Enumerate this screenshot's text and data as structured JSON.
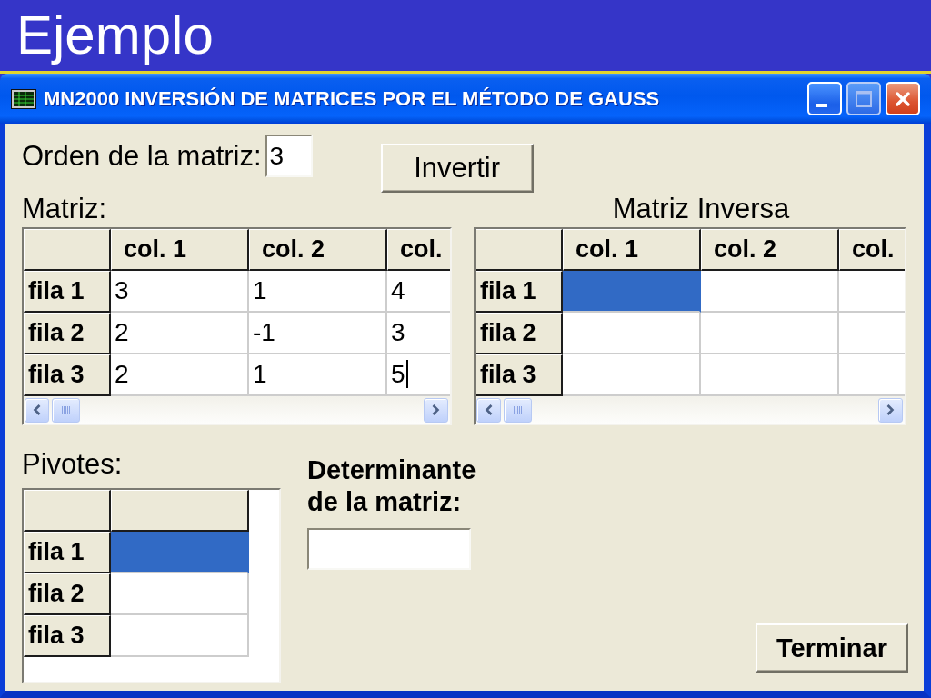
{
  "slide": {
    "title": "Ejemplo"
  },
  "window": {
    "title": "MN2000 INVERSIÓN DE MATRICES POR EL MÉTODO DE GAUSS",
    "controls": [
      {
        "kind": "minimize",
        "disabled": false
      },
      {
        "kind": "maximize",
        "disabled": true
      },
      {
        "kind": "close",
        "disabled": false
      }
    ]
  },
  "order": {
    "label": "Orden de la matriz:",
    "value": "3"
  },
  "invert_button": {
    "label": "Invertir"
  },
  "matrix": {
    "label": "Matriz:",
    "columns": [
      "col. 1",
      "col. 2",
      "col."
    ],
    "rows": [
      {
        "header": "fila 1",
        "cells": [
          {
            "value": "3",
            "selected": false,
            "caret": false
          },
          {
            "value": "1",
            "selected": false,
            "caret": false
          },
          {
            "value": "4",
            "selected": false,
            "caret": false
          }
        ]
      },
      {
        "header": "fila 2",
        "cells": [
          {
            "value": "2",
            "selected": false,
            "caret": false
          },
          {
            "value": "-1",
            "selected": false,
            "caret": false
          },
          {
            "value": "3",
            "selected": false,
            "caret": false
          }
        ]
      },
      {
        "header": "fila 3",
        "cells": [
          {
            "value": "2",
            "selected": false,
            "caret": false
          },
          {
            "value": "1",
            "selected": false,
            "caret": false
          },
          {
            "value": "5",
            "selected": false,
            "caret": true
          }
        ]
      }
    ]
  },
  "inverse_matrix": {
    "label": "Matriz Inversa",
    "columns": [
      "col. 1",
      "col. 2",
      "col."
    ],
    "rows": [
      {
        "header": "fila 1",
        "cells": [
          {
            "selected": true
          },
          {
            "selected": false
          },
          {
            "selected": false
          }
        ]
      },
      {
        "header": "fila 2",
        "cells": [
          {
            "selected": false
          },
          {
            "selected": false
          },
          {
            "selected": false
          }
        ]
      },
      {
        "header": "fila 3",
        "cells": [
          {
            "selected": false
          },
          {
            "selected": false
          },
          {
            "selected": false
          }
        ]
      }
    ]
  },
  "pivots": {
    "label": "Pivotes:",
    "rows": [
      {
        "header": "fila 1",
        "cells": [
          {
            "selected": true
          }
        ]
      },
      {
        "header": "fila 2",
        "cells": [
          {
            "selected": false
          }
        ]
      },
      {
        "header": "fila 3",
        "cells": [
          {
            "selected": false
          }
        ]
      }
    ]
  },
  "determinant": {
    "label": "Determinante de la matriz:"
  },
  "finish_button": {
    "label": "Terminar"
  }
}
